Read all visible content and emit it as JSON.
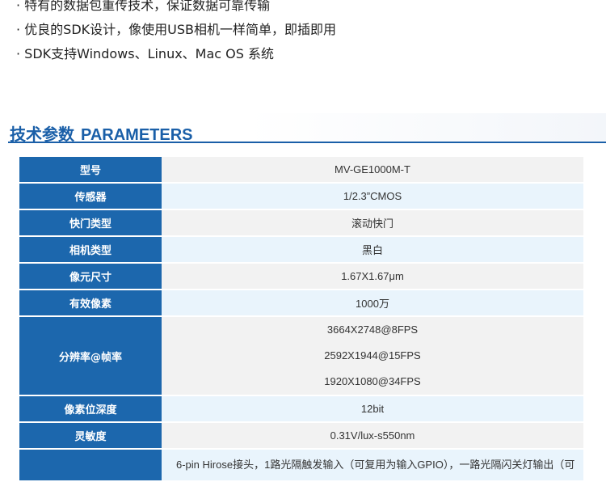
{
  "features": [
    "· 特有的数据包重传技术，保证数据可靠传输",
    "· 优良的SDK设计，像使用USB相机一样简单，即插即用",
    "· SDK支持Windows、Linux、Mac OS 系统"
  ],
  "section": {
    "title_cn": "技术参数",
    "title_en": "PARAMETERS"
  },
  "params": [
    {
      "label": "型号",
      "value": "MV-GE1000M-T"
    },
    {
      "label": "传感器",
      "value": "1/2.3”CMOS"
    },
    {
      "label": "快门类型",
      "value": "滚动快门"
    },
    {
      "label": "相机类型",
      "value": "黑白"
    },
    {
      "label": "像元尺寸",
      "value": "1.67X1.67μm"
    },
    {
      "label": "有效像素",
      "value": "1000万"
    },
    {
      "label": "分辨率@帧率",
      "values": [
        "3664X2748@8FPS",
        "2592X1944@15FPS",
        "1920X1080@34FPS"
      ]
    },
    {
      "label": "像素位深度",
      "value": "12bit"
    },
    {
      "label": "灵敏度",
      "value": "0.31V/lux-s550nm"
    },
    {
      "label": "",
      "value": "6-pin Hirose接头，1路光隔触发输入（可复用为输入GPIO），一路光隔闪关灯输出（可"
    }
  ]
}
